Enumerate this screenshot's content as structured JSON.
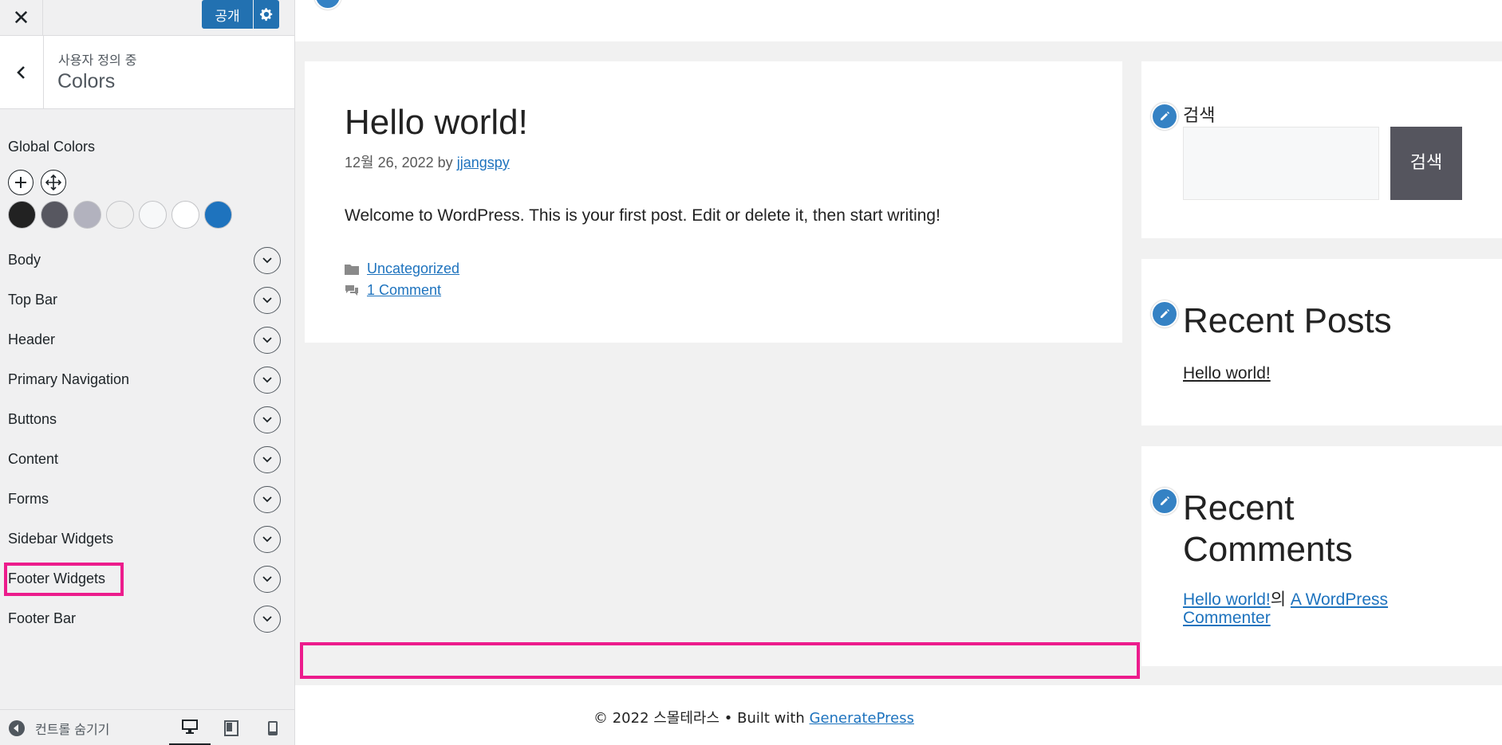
{
  "sidebar": {
    "close_glyph": "✕",
    "publish_label": "공개",
    "breadcrumb": "사용자 정의 중",
    "section_title": "Colors",
    "global_colors_label": "Global Colors",
    "swatches": [
      "#222222",
      "#575760",
      "#b2b2be",
      "#f0f0f0",
      "#f7f8f9",
      "#ffffff",
      "#1e73be"
    ],
    "accordion": [
      {
        "label": "Body"
      },
      {
        "label": "Top Bar"
      },
      {
        "label": "Header"
      },
      {
        "label": "Primary Navigation"
      },
      {
        "label": "Buttons"
      },
      {
        "label": "Content"
      },
      {
        "label": "Forms"
      },
      {
        "label": "Sidebar Widgets"
      },
      {
        "label": "Footer Widgets"
      },
      {
        "label": "Footer Bar"
      }
    ],
    "hide_controls_label": "컨트롤 숨기기"
  },
  "preview": {
    "post": {
      "title": "Hello world!",
      "date": "12월 26, 2022",
      "by": "by",
      "author": "jjangspy",
      "body": "Welcome to WordPress. This is your first post. Edit or delete it, then start writing!",
      "category": "Uncategorized",
      "comments": "1 Comment"
    },
    "widgets": {
      "search_label": "검색",
      "search_button": "검색",
      "recent_posts_title": "Recent Posts",
      "recent_posts_items": [
        "Hello world!"
      ],
      "recent_comments_title": "Recent Comments",
      "recent_comment_post": "Hello world!",
      "recent_comment_joiner": "의",
      "recent_comment_author": "A WordPress Commenter"
    },
    "footer": {
      "prefix": "© 2022 스몰테라스 • Built with",
      "link": "GeneratePress"
    }
  },
  "colors": {
    "accent": "#2271b1",
    "highlight": "#ec1c8c",
    "edit_shortcut": "#3582c4"
  }
}
